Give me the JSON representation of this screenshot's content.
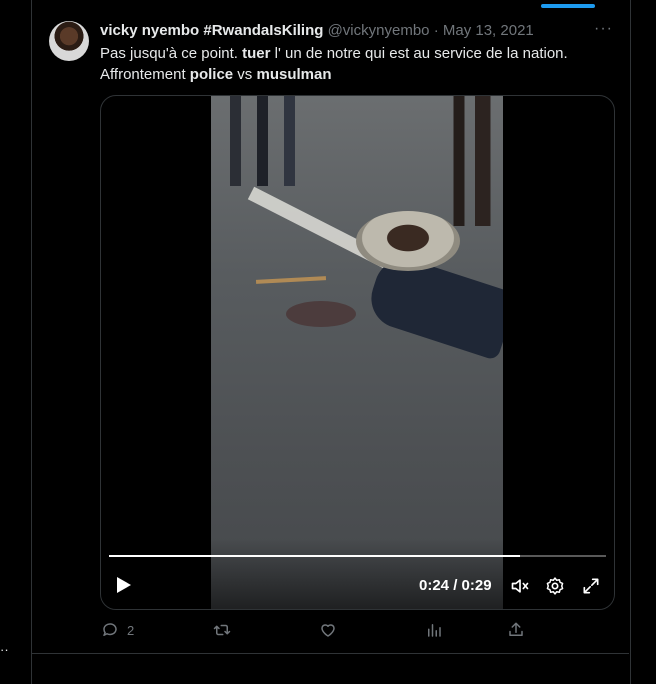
{
  "tweet": {
    "display_name": "vicky nyembo #RwandaIsKiling",
    "handle": "@vickynyembo",
    "separator": "·",
    "date": "May 13, 2021",
    "text_parts": [
      {
        "text": "Pas jusqu'à ce point. ",
        "bold": false
      },
      {
        "text": "tuer",
        "bold": true
      },
      {
        "text": " l' un de notre qui est au service de la nation.",
        "bold": false
      },
      {
        "text": "Affrontement ",
        "bold": false,
        "newline_before": true
      },
      {
        "text": "police",
        "bold": true
      },
      {
        "text": " vs ",
        "bold": false
      },
      {
        "text": "musulman",
        "bold": true
      }
    ]
  },
  "video": {
    "current_time": "0:24",
    "duration": "0:29",
    "time_display": "0:24 / 0:29",
    "progress": 0.827
  },
  "actions": {
    "reply_count": "2"
  },
  "side": {
    "dots": "··"
  },
  "colors": {
    "accent": "#1d9bf0",
    "muted": "#71767b",
    "text": "#e7e9ea"
  },
  "icons": [
    "more-icon",
    "play-icon",
    "volume-muted-icon",
    "settings-icon",
    "fullscreen-icon",
    "reply-icon",
    "retweet-icon",
    "like-icon",
    "analytics-icon",
    "share-icon"
  ]
}
